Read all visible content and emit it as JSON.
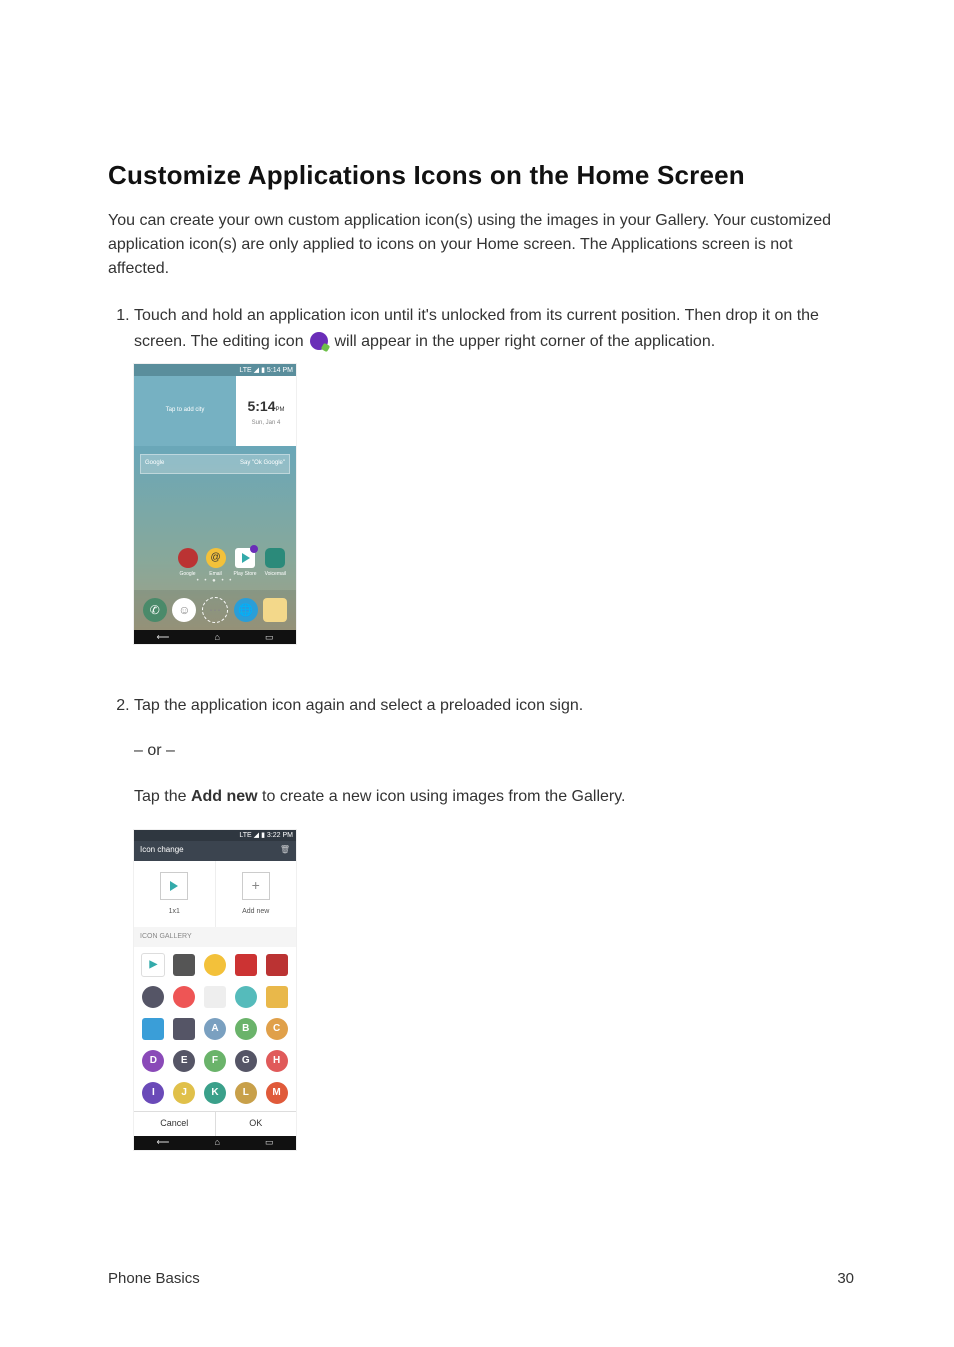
{
  "title": "Customize Applications Icons on the Home Screen",
  "intro": "You can create your own custom application icon(s) using the images in your Gallery. Your customized application icon(s) are only applied to icons on your Home screen. The Applications screen is not affected.",
  "steps": {
    "one_a": "Touch and hold an application icon until it's unlocked from its current position. Then drop it on the screen. The editing icon ",
    "one_b": " will appear in the upper right corner of the application.",
    "two": "Tap the application icon again and select a preloaded icon sign.",
    "or": "– or –",
    "two_b_pre": "Tap the ",
    "two_b_bold": "Add new",
    "two_b_post": " to create a new icon using images from the Gallery."
  },
  "ss1": {
    "status_time": "5:14 PM",
    "status_net": "LTE",
    "weather_prompt": "Tap to add city",
    "clock_time": "5:14",
    "clock_ampm": "PM",
    "clock_date": "Sun, Jan 4",
    "search_left": "Google",
    "search_right": "Say \"Ok Google\"",
    "apps": [
      {
        "label": "Google"
      },
      {
        "label": "Email"
      },
      {
        "label": "Play Store"
      },
      {
        "label": "Voicemail"
      }
    ]
  },
  "ss2": {
    "status_time": "3:22 PM",
    "status_net": "LTE",
    "header": "Icon change",
    "opt1": "1x1",
    "opt2": "Add new",
    "section": "ICON GALLERY",
    "letters": [
      "A",
      "B",
      "C",
      "D",
      "E",
      "F",
      "G",
      "H",
      "I",
      "J",
      "K",
      "L",
      "M"
    ],
    "cancel": "Cancel",
    "ok": "OK"
  },
  "footer_left": "Phone Basics",
  "footer_right": "30"
}
